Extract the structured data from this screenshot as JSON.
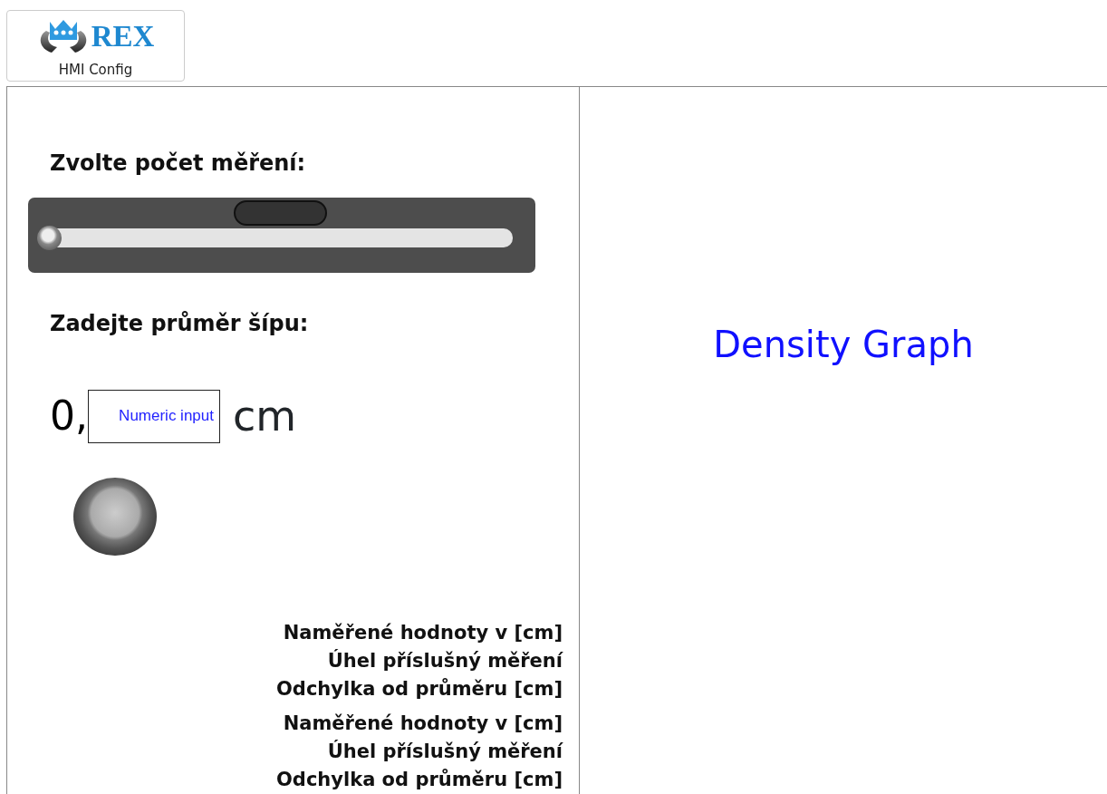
{
  "logo": {
    "brand": "REX",
    "caption": "HMI Config"
  },
  "left_panel": {
    "count_heading": "Zvolte počet měření:",
    "slider": {
      "level": 0
    },
    "diameter_heading": "Zadejte průměr šípu:",
    "diameter": {
      "prefix": "0,",
      "placeholder": "Numeric input",
      "unit": "cm"
    },
    "label_groups": [
      {
        "lines": [
          "Naměřené hodnoty v [cm]",
          "Úhel příslušný měření",
          "Odchylka od průměru [cm]"
        ]
      },
      {
        "lines": [
          "Naměřené hodnoty v [cm]",
          "Úhel příslušný měření",
          "Odchylka od průměru [cm]"
        ]
      }
    ]
  },
  "right_panel": {
    "title": "Density Graph"
  }
}
